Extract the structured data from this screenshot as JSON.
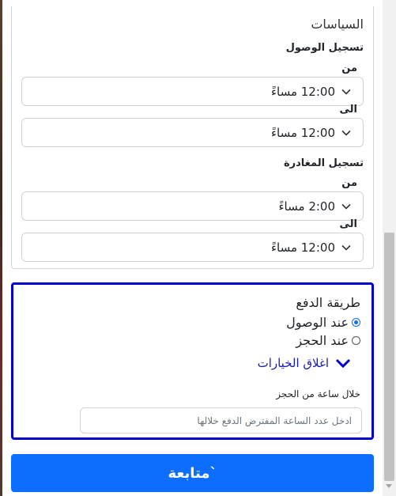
{
  "policies": {
    "title": "السياسات",
    "checkin": {
      "heading": "تسجيل الوصول",
      "from_label": "من",
      "from_value": "12:00 مساءً",
      "to_label": "الى",
      "to_value": "12:00 مساءً"
    },
    "checkout": {
      "heading": "تسجيل المغادرة",
      "from_label": "من",
      "from_value": "2:00 مساءً",
      "to_label": "الى",
      "to_value": "12:00 مساءً"
    }
  },
  "payment": {
    "title": "طريقة الدفع",
    "options": [
      {
        "label": "عند الوصول",
        "selected": true
      },
      {
        "label": "عند الحجز",
        "selected": false
      }
    ],
    "toggle_label": "اغلاق الخيارات",
    "hours_label": "خلال ساعة من الحجز",
    "hours_placeholder": "ادخل عدد الساعة المفترض الدفع خلالها"
  },
  "continue_label": "متابعة`",
  "colors": {
    "primary": "#0d6efd",
    "panel_border": "#0000cc",
    "link": "#1a1ab0"
  }
}
